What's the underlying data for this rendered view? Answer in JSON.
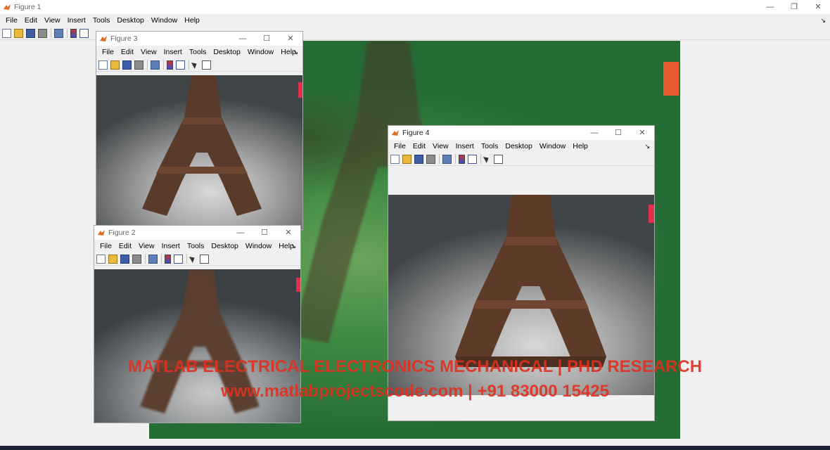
{
  "menus": [
    "File",
    "Edit",
    "View",
    "Insert",
    "Tools",
    "Desktop",
    "Window",
    "Help"
  ],
  "window_controls": {
    "minimize": "—",
    "maximize": "☐",
    "restore": "❐",
    "close": "✕"
  },
  "dock_glyph": "↘",
  "figure1": {
    "title": "Figure 1"
  },
  "figure3": {
    "title": "Figure 3"
  },
  "figure2": {
    "title": "Figure 2"
  },
  "figure4": {
    "title": "Figure 4"
  },
  "toolbar_icons": [
    "new-figure-icon",
    "open-file-icon",
    "save-icon",
    "print-icon",
    "link-plot-icon",
    "colorbar-icon",
    "legend-icon",
    "pointer-icon",
    "property-inspector-icon"
  ],
  "watermark": {
    "line1": "MATLAB ELECTRICAL ELECTRONICS MECHANICAL | PHD RESEARCH",
    "line2": "www.matlabprojectscode.com | +91 83000 15425"
  },
  "colors": {
    "watermark": "#e03020",
    "window_bg": "#f0f0f0",
    "seabed_green": "#3f8a43"
  }
}
